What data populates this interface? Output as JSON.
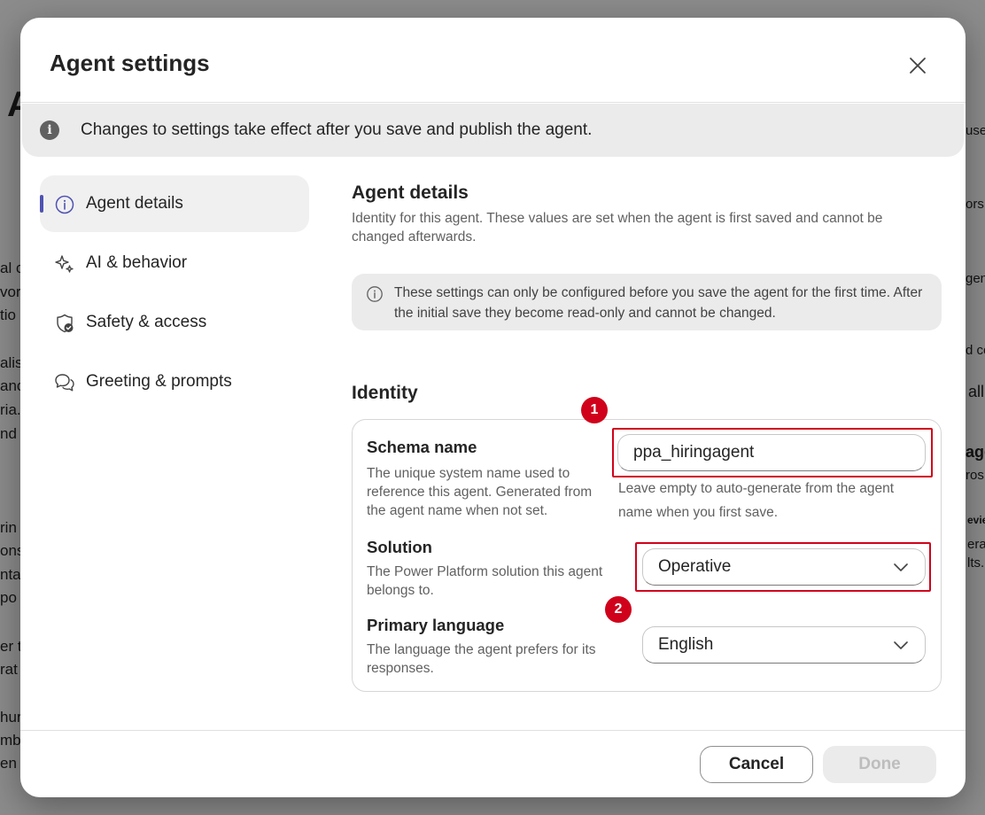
{
  "background_fragments": [
    "A",
    "al c",
    "vor",
    "tio",
    "alis",
    "anc",
    "ria.",
    "nd c",
    "rin",
    "ons",
    "nta",
    "po",
    "er t",
    "rat",
    "hur",
    "mbe",
    "en",
    "use",
    "ors",
    "gen",
    "d co",
    "all",
    "age",
    "ros",
    "evie",
    "era",
    "lts."
  ],
  "dialog": {
    "title": "Agent settings",
    "close_icon": "close-icon",
    "banner_text": "Changes to settings take effect after you save and publish the agent."
  },
  "nav": {
    "items": [
      {
        "label": "Agent details",
        "icon": "info-icon",
        "active": true
      },
      {
        "label": "AI & behavior",
        "icon": "sparkle-icon",
        "active": false
      },
      {
        "label": "Safety & access",
        "icon": "shield-check-icon",
        "active": false
      },
      {
        "label": "Greeting & prompts",
        "icon": "chat-bubbles-icon",
        "active": false
      }
    ]
  },
  "details": {
    "title": "Agent details",
    "description": "Identity for this agent. These values are set when the agent is first saved and cannot be changed afterwards.",
    "note": "These settings can only be configured before you save the agent for the first time. After the initial save they become read-only and cannot be changed."
  },
  "identity": {
    "title": "Identity",
    "schema_name": {
      "label": "Schema name",
      "help": "The unique system name used to reference this agent. Generated from the agent name when not set.",
      "value": "ppa_hiringagent",
      "hint": "Leave empty to auto-generate from the agent name when you first save."
    },
    "solution": {
      "label": "Solution",
      "help": "The Power Platform solution this agent belongs to.",
      "value": "Operative"
    },
    "primary_language": {
      "label": "Primary language",
      "help": "The language the agent prefers for its responses.",
      "value": "English"
    }
  },
  "annotations": {
    "marker1": "1",
    "marker2": "2",
    "highlight_color": "#d0021b"
  },
  "footer": {
    "cancel_label": "Cancel",
    "done_label": "Done"
  },
  "colors": {
    "accent": "#4f52b2",
    "done_disabled_text": "#bdbdbd"
  }
}
